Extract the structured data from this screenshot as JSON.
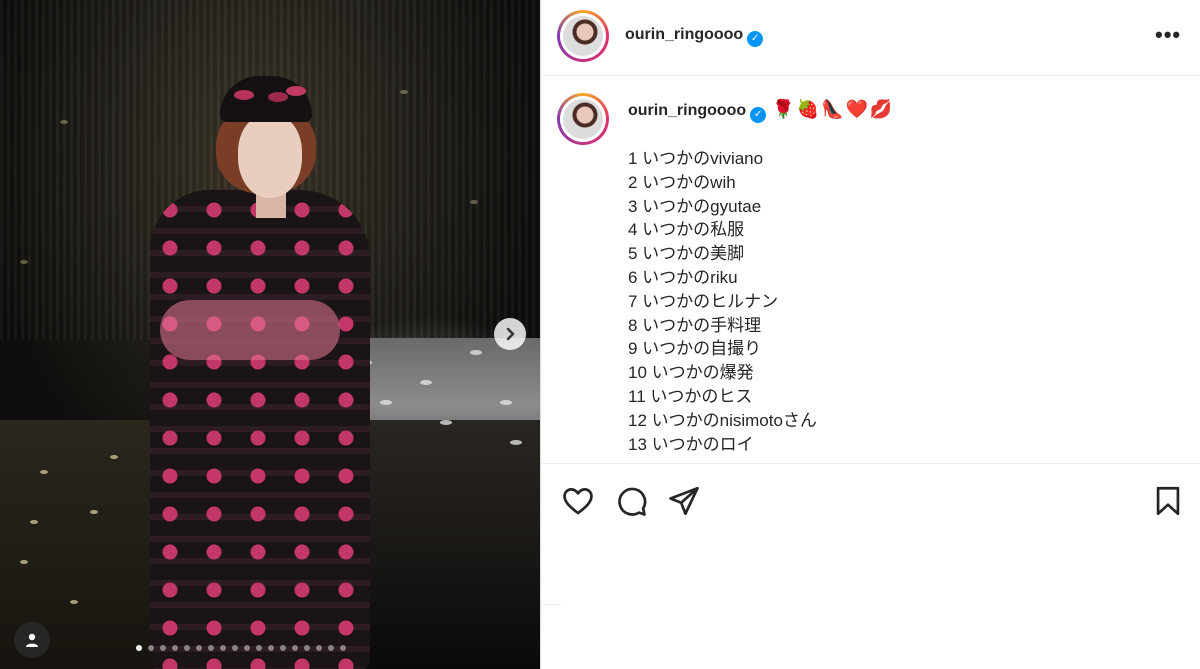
{
  "post": {
    "photo_alt": "",
    "carousel": {
      "slide_count": 18,
      "active_index": 0
    }
  },
  "header": {
    "username": "ourin_ringoooo",
    "verified": true,
    "more_label": "•••"
  },
  "caption": {
    "username": "ourin_ringoooo",
    "emojis": "🌹🍓👠❤️💋",
    "lines": [
      "1 いつかのviviano",
      "2 いつかのwih",
      "3 いつかのgyutae",
      "4 いつかの私服",
      "5 いつかの美脚",
      "6 いつかのriku",
      "7 いつかのヒルナン",
      "8 いつかの手料理",
      "9 いつかの自撮り",
      "10 いつかの爆発",
      "11 いつかのヒス",
      "12 いつかのnisimotoさん",
      "13 いつかのロイ"
    ]
  },
  "icons": {
    "like": "heart-icon",
    "comment": "comment-icon",
    "share": "send-icon",
    "save": "bookmark-icon",
    "next": "chevron-right-icon",
    "tags": "user-tag-icon"
  },
  "colors": {
    "verified": "#0095f6",
    "text": "#262626",
    "border": "#dbdbdb"
  }
}
